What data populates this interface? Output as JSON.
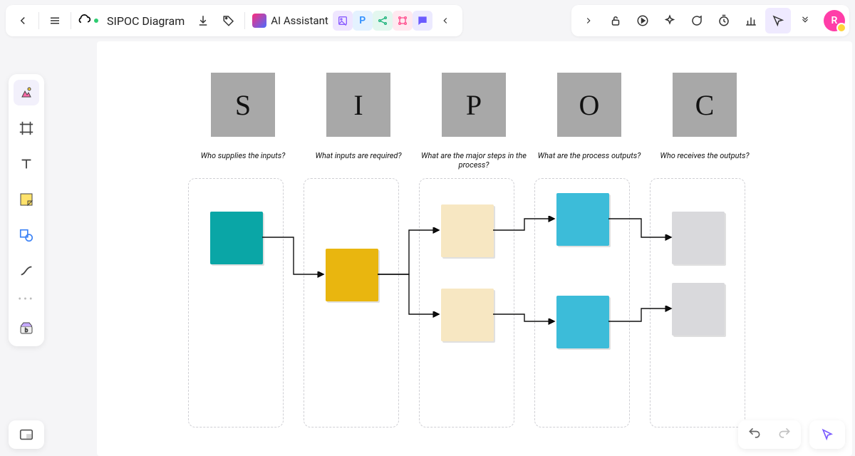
{
  "doc": {
    "title": "SIPOC Diagram"
  },
  "ai": {
    "label": "AI Assistant"
  },
  "avatar": {
    "initial": "R"
  },
  "headers": [
    {
      "letter": "S",
      "subtext": "Who supplies the inputs?"
    },
    {
      "letter": "I",
      "subtext": "What inputs are required?"
    },
    {
      "letter": "P",
      "subtext": "What are the major steps in the process?"
    },
    {
      "letter": "O",
      "subtext": "What are the process outputs?"
    },
    {
      "letter": "C",
      "subtext": "Who receives the outputs?"
    }
  ],
  "icons": {
    "mini_p": "P"
  }
}
